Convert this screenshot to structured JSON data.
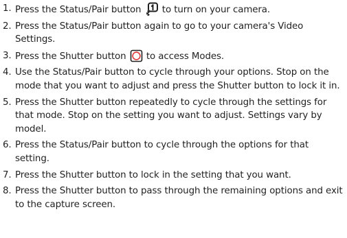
{
  "steps": [
    {
      "number": "1.",
      "before": "Press the Status/Pair button",
      "icon": "status-pair-button-icon",
      "after": "to turn on your camera."
    },
    {
      "number": "2.",
      "text": "Press the Status/Pair button again to go to your camera's Video Settings."
    },
    {
      "number": "3.",
      "before": "Press the Shutter button",
      "icon": "shutter-button-icon",
      "after": "to access Modes.",
      "icon_color": "#e03a3a"
    },
    {
      "number": "4.",
      "text": "Use the Status/Pair button to cycle through your options. Stop on the mode that you want to adjust and press the Shutter button to lock it in."
    },
    {
      "number": "5.",
      "text": "Press the Shutter button repeatedly to cycle through the settings for that mode. Stop on the setting you want to adjust. Settings vary by model."
    },
    {
      "number": "6.",
      "text": "Press the Status/Pair button to cycle through the options for that setting."
    },
    {
      "number": "7.",
      "text": "Press the Shutter button to lock in the setting that you want."
    },
    {
      "number": "8.",
      "text": "Press the Shutter button to pass through the remaining options and exit to the capture screen."
    }
  ]
}
